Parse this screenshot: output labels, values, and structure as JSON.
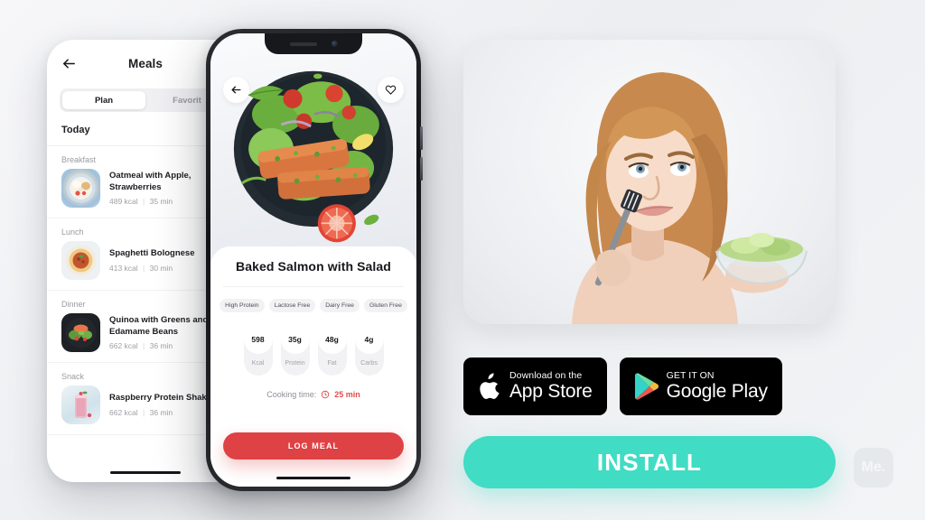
{
  "background_color": "#f2f3f5",
  "left_phone": {
    "back_icon": "back-arrow-icon",
    "title": "Meals",
    "tabs": [
      {
        "label": "Plan",
        "active": true
      },
      {
        "label": "Favorit",
        "active": false
      }
    ],
    "today_label": "Today",
    "sections": [
      {
        "label": "Breakfast",
        "meal": {
          "name": "Oatmeal with Apple, Strawberries",
          "kcal": "489 kcal",
          "time": "35 min"
        }
      },
      {
        "label": "Lunch",
        "meal": {
          "name": "Spaghetti Bolognese",
          "kcal": "413 kcal",
          "time": "30 min"
        }
      },
      {
        "label": "Dinner",
        "meal": {
          "name": "Quinoa with Greens and Edamame Beans",
          "kcal": "662 kcal",
          "time": "36 min"
        }
      },
      {
        "label": "Snack",
        "meal": {
          "name": "Raspberry Protein Shake",
          "kcal": "662 kcal",
          "time": "36 min"
        }
      }
    ],
    "meta_divider": "|"
  },
  "center_phone": {
    "back_icon": "back-arrow-icon",
    "favorite_icon": "heart-icon",
    "hero_image_alt": "baked-salmon-salad-bowl",
    "dish_title": "Baked Salmon with Salad",
    "tags": [
      "High Protein",
      "Lactose Free",
      "Dairy Free",
      "Gluten Free"
    ],
    "nutrition": [
      {
        "value": "598",
        "label": "Kcal"
      },
      {
        "value": "35g",
        "label": "Protein"
      },
      {
        "value": "48g",
        "label": "Fat"
      },
      {
        "value": "4g",
        "label": "Carbs"
      }
    ],
    "cooking_time_label": "Cooking time:",
    "cooking_time_value": "25 min",
    "cooking_time_icon": "clock-icon",
    "log_button": "LOG MEAL",
    "accent_color": "#df4244"
  },
  "right_panel": {
    "photo_alt": "woman-holding-fork-and-salad-bowl",
    "app_store": {
      "icon": "apple-logo-icon",
      "top": "Download on the",
      "bottom": "App Store"
    },
    "google_play": {
      "icon": "google-play-icon",
      "top": "GET IT ON",
      "bottom": "Google Play"
    },
    "install_button": "INSTALL",
    "install_color": "#40dcc4",
    "watermark": "Me."
  }
}
